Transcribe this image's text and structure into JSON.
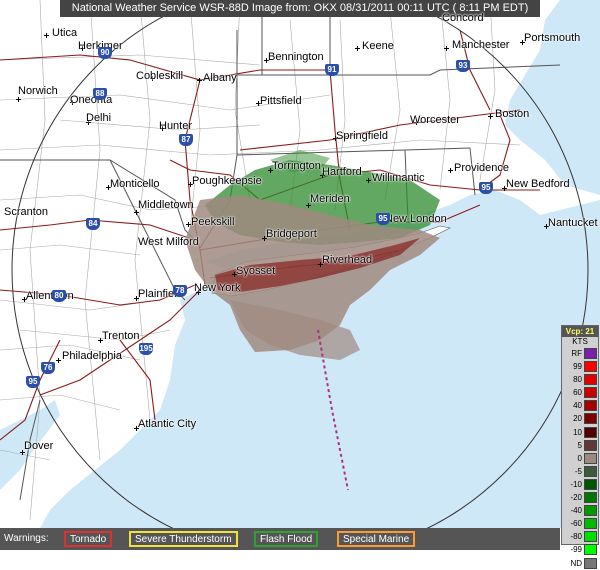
{
  "header": {
    "title": "National Weather Service WSR-88D Image from:  OKX  08/31/2011  00:11 UTC  ( 8:11 PM EDT)"
  },
  "places": [
    {
      "id": "utica",
      "name": "Utica"
    },
    {
      "id": "herkimer",
      "name": "Herkimer"
    },
    {
      "id": "cobleskill",
      "name": "Cobleskill"
    },
    {
      "id": "albany",
      "name": "Albany"
    },
    {
      "id": "norwich",
      "name": "Norwich"
    },
    {
      "id": "oneonta",
      "name": "Oneonta"
    },
    {
      "id": "delhi",
      "name": "Delhi"
    },
    {
      "id": "hunter",
      "name": "Hunter"
    },
    {
      "id": "bennington",
      "name": "Bennington"
    },
    {
      "id": "keene",
      "name": "Keene"
    },
    {
      "id": "concord",
      "name": "Concord"
    },
    {
      "id": "manchester",
      "name": "Manchester"
    },
    {
      "id": "portsmouth",
      "name": "Portsmouth"
    },
    {
      "id": "pittsfield",
      "name": "Pittsfield"
    },
    {
      "id": "worcester",
      "name": "Worcester"
    },
    {
      "id": "boston",
      "name": "Boston"
    },
    {
      "id": "springfield",
      "name": "Springfield"
    },
    {
      "id": "torrington",
      "name": "Torrington"
    },
    {
      "id": "hartford",
      "name": "Hartford"
    },
    {
      "id": "willimantic",
      "name": "Willimantic"
    },
    {
      "id": "providence",
      "name": "Providence"
    },
    {
      "id": "new-bedford",
      "name": "New Bedford"
    },
    {
      "id": "poughkeepsie",
      "name": "Poughkeepsie"
    },
    {
      "id": "monticello",
      "name": "Monticello"
    },
    {
      "id": "middletown",
      "name": "Middletown"
    },
    {
      "id": "meriden",
      "name": "Meriden"
    },
    {
      "id": "new-london",
      "name": "New London"
    },
    {
      "id": "nantucket",
      "name": "Nantucket"
    },
    {
      "id": "scranton",
      "name": "Scranton"
    },
    {
      "id": "peekskill",
      "name": "Peekskill"
    },
    {
      "id": "bridgeport",
      "name": "Bridgeport"
    },
    {
      "id": "west-milford",
      "name": "West Milford"
    },
    {
      "id": "riverhead",
      "name": "Riverhead"
    },
    {
      "id": "syosset",
      "name": "Syosset"
    },
    {
      "id": "allentown",
      "name": "Allentown"
    },
    {
      "id": "plainfield",
      "name": "Plainfield"
    },
    {
      "id": "new-york",
      "name": "New York"
    },
    {
      "id": "trenton",
      "name": "Trenton"
    },
    {
      "id": "philadelphia",
      "name": "Philadelphia"
    },
    {
      "id": "atlantic-city",
      "name": "Atlantic City"
    },
    {
      "id": "dover",
      "name": "Dover"
    }
  ],
  "shields": [
    "90",
    "88",
    "91",
    "93",
    "87",
    "84",
    "95",
    "95",
    "80",
    "78",
    "195",
    "76",
    "95"
  ],
  "legend": {
    "title": "Vcp: 21",
    "units": "KTS",
    "rows": [
      {
        "label": "RF",
        "color": "#7a1fa8"
      },
      {
        "label": "99",
        "color": "#ff0000"
      },
      {
        "label": "80",
        "color": "#e00000"
      },
      {
        "label": "60",
        "color": "#c80000"
      },
      {
        "label": "40",
        "color": "#a50000"
      },
      {
        "label": "20",
        "color": "#7a0000"
      },
      {
        "label": "10",
        "color": "#500000"
      },
      {
        "label": "5",
        "color": "#603838"
      },
      {
        "label": "0",
        "color": "#9a8a80"
      },
      {
        "label": "-5",
        "color": "#3a5a3a"
      },
      {
        "label": "-10",
        "color": "#005500"
      },
      {
        "label": "-20",
        "color": "#007700"
      },
      {
        "label": "-40",
        "color": "#009900"
      },
      {
        "label": "-60",
        "color": "#00bb00"
      },
      {
        "label": "-80",
        "color": "#00dd00"
      },
      {
        "label": "-99",
        "color": "#00ff00"
      },
      {
        "label": "ND",
        "color": "#777777"
      }
    ]
  },
  "warnings": {
    "label": "Warnings:",
    "items": [
      {
        "label": "Tornado",
        "color": "#e03030"
      },
      {
        "label": "Severe Thunderstorm",
        "color": "#f0e040"
      },
      {
        "label": "Flash Flood",
        "color": "#30a030"
      },
      {
        "label": "Special Marine",
        "color": "#ff9933"
      }
    ]
  },
  "colors": {
    "ocean": "#cfe8f8",
    "land": "#ffffff",
    "county_lines": "#9a9a9a",
    "state_lines": "#555555",
    "highways": "#8b1a1a",
    "range_ring": "#333333",
    "radar_green": "#2e8b2e",
    "radar_gray": "#a08a80",
    "radar_red": "#7a0000"
  }
}
